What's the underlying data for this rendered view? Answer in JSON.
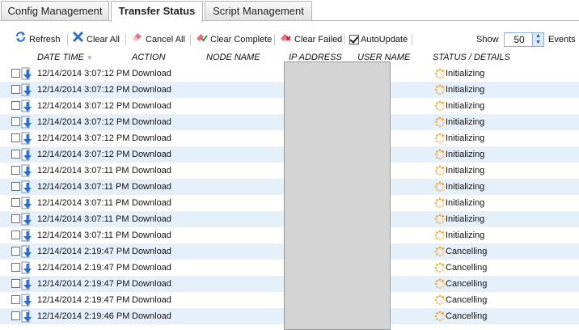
{
  "tabs": [
    {
      "label": "Config Management",
      "active": false
    },
    {
      "label": "Transfer Status",
      "active": true
    },
    {
      "label": "Script Management",
      "active": false
    }
  ],
  "toolbar": {
    "refresh": "Refresh",
    "clear_all": "Clear All",
    "cancel_all": "Cancel All",
    "clear_complete": "Clear Complete",
    "clear_failed": "Clear Failed",
    "auto_update": "AutoUpdate",
    "auto_update_checked": true,
    "show_label": "Show",
    "show_value": "50",
    "events_label": "Events"
  },
  "columns": {
    "date_time": "DATE TIME",
    "action": "ACTION",
    "node_name": "NODE NAME",
    "ip_address": "IP ADDRESS",
    "user_name": "USER NAME",
    "status": "STATUS / DETAILS"
  },
  "rows": [
    {
      "datetime": "12/14/2014 3:07:12 PM",
      "action": "Download",
      "status": "Initializing"
    },
    {
      "datetime": "12/14/2014 3:07:12 PM",
      "action": "Download",
      "status": "Initializing"
    },
    {
      "datetime": "12/14/2014 3:07:12 PM",
      "action": "Download",
      "status": "Initializing"
    },
    {
      "datetime": "12/14/2014 3:07:12 PM",
      "action": "Download",
      "status": "Initializing"
    },
    {
      "datetime": "12/14/2014 3:07:12 PM",
      "action": "Download",
      "status": "Initializing"
    },
    {
      "datetime": "12/14/2014 3:07:12 PM",
      "action": "Download",
      "status": "Initializing"
    },
    {
      "datetime": "12/14/2014 3:07:11 PM",
      "action": "Download",
      "status": "Initializing"
    },
    {
      "datetime": "12/14/2014 3:07:11 PM",
      "action": "Download",
      "status": "Initializing"
    },
    {
      "datetime": "12/14/2014 3:07:11 PM",
      "action": "Download",
      "status": "Initializing"
    },
    {
      "datetime": "12/14/2014 3:07:11 PM",
      "action": "Download",
      "status": "Initializing"
    },
    {
      "datetime": "12/14/2014 3:07:11 PM",
      "action": "Download",
      "status": "Initializing"
    },
    {
      "datetime": "12/14/2014 2:19:47 PM",
      "action": "Download",
      "status": "Cancelling"
    },
    {
      "datetime": "12/14/2014 2:19:47 PM",
      "action": "Download",
      "status": "Cancelling"
    },
    {
      "datetime": "12/14/2014 2:19:47 PM",
      "action": "Download",
      "status": "Cancelling"
    },
    {
      "datetime": "12/14/2014 2:19:47 PM",
      "action": "Download",
      "status": "Cancelling"
    },
    {
      "datetime": "12/14/2014 2:19:46 PM",
      "action": "Download",
      "status": "Cancelling"
    }
  ],
  "icons": {
    "refresh": "refresh-icon",
    "clear_all": "x-icon",
    "cancel_all": "eraser-icon",
    "clear_complete": "clear-complete-icon",
    "clear_failed": "clear-failed-icon",
    "row_action": "download-arrow-icon",
    "row_status": "spinner-icon"
  },
  "colors": {
    "row_alt": "#e6f0fb",
    "accent_blue": "#2a6fc9",
    "spinner": "#f0a020"
  }
}
